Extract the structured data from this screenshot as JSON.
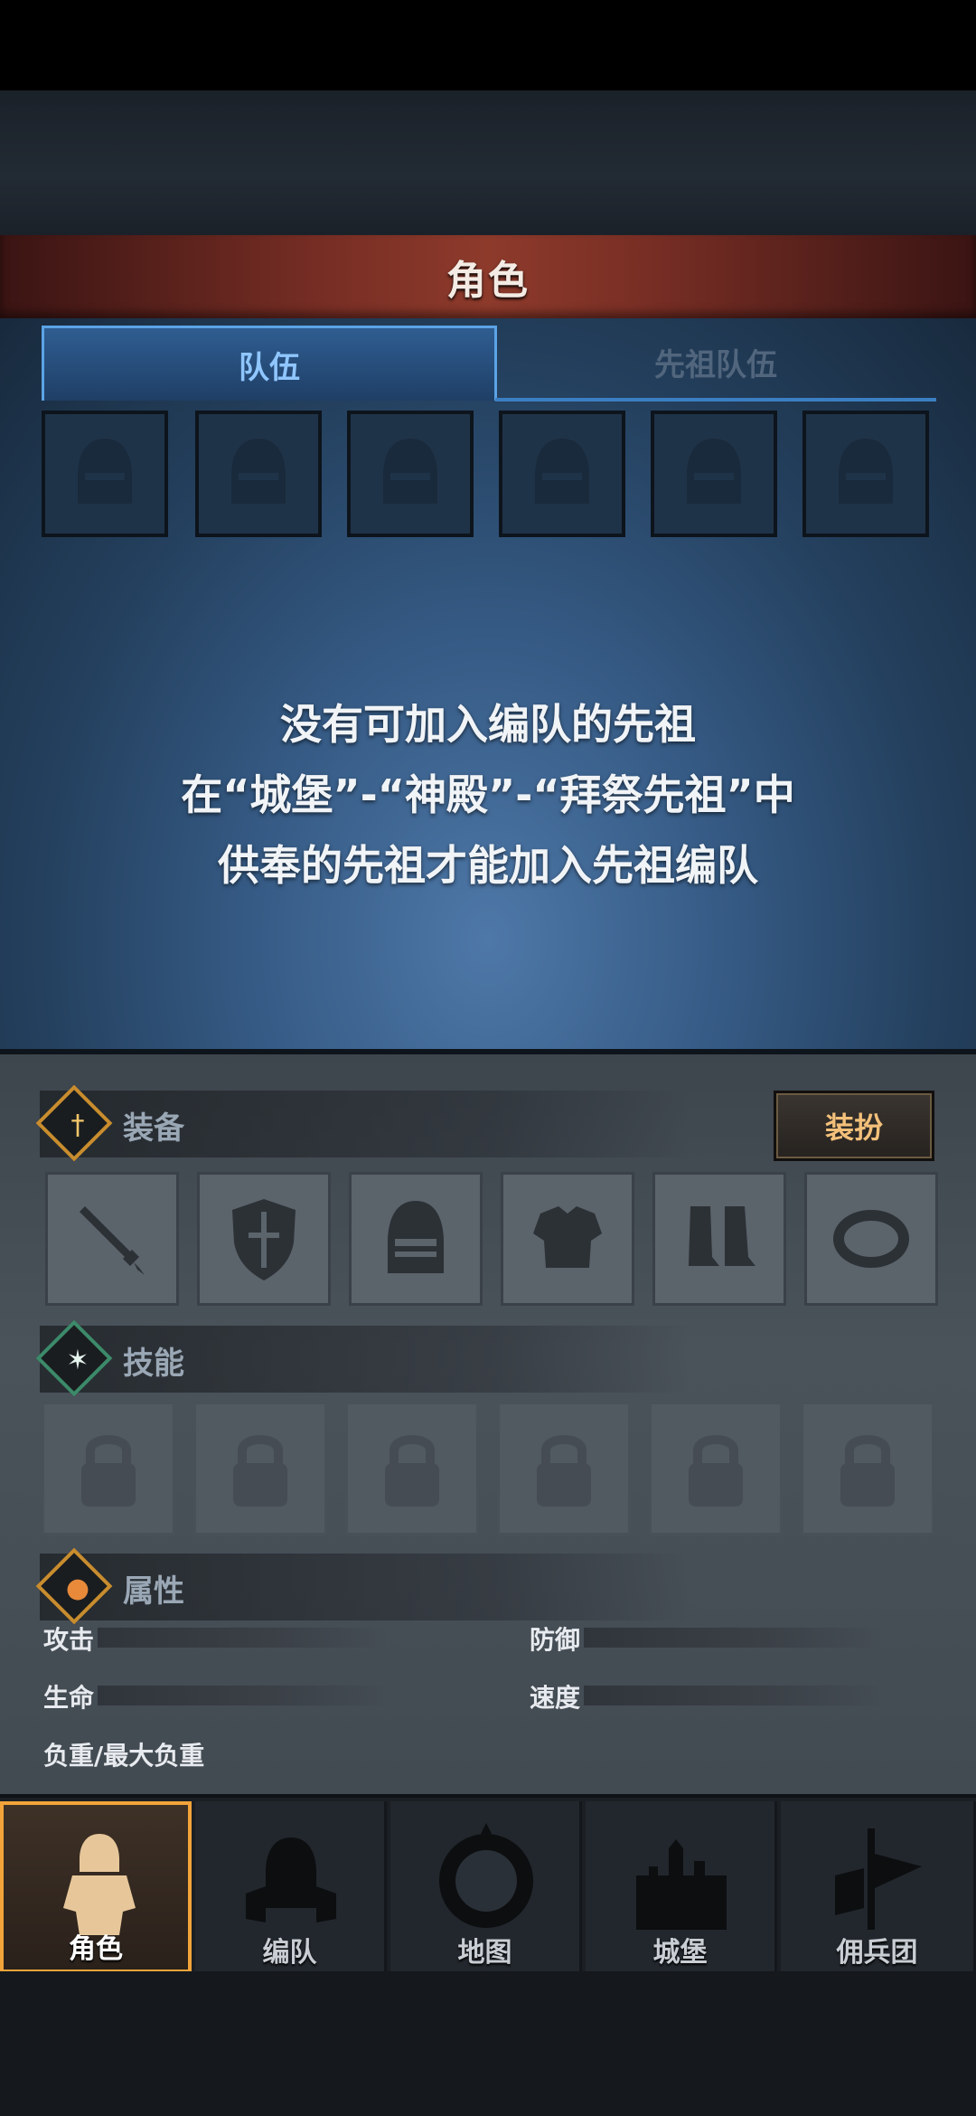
{
  "header": {
    "title": "角色"
  },
  "tabs": [
    {
      "label": "队伍",
      "active": true
    },
    {
      "label": "先祖队伍",
      "active": false
    }
  ],
  "message": {
    "line1": "没有可加入编队的先祖",
    "line2": "在“城堡”-“神殿”-“拜祭先祖”中",
    "line3": "供奉的先祖才能加入先祖编队"
  },
  "equipment": {
    "title": "装备",
    "dress_button": "装扮",
    "slots": [
      "sword-icon",
      "shield-icon",
      "helmet-icon",
      "armor-icon",
      "boots-icon",
      "ring-icon"
    ]
  },
  "skills": {
    "title": "技能",
    "slots_locked": 6
  },
  "attributes": {
    "title": "属性",
    "attack": "攻击",
    "defense": "防御",
    "life": "生命",
    "speed": "速度",
    "weight": "负重/最大负重"
  },
  "nav": [
    {
      "label": "角色",
      "icon": "knight-icon",
      "active": true
    },
    {
      "label": "编队",
      "icon": "squad-icon",
      "active": false
    },
    {
      "label": "地图",
      "icon": "compass-map-icon",
      "active": false
    },
    {
      "label": "城堡",
      "icon": "castle-icon",
      "active": false
    },
    {
      "label": "佣兵团",
      "icon": "mercenary-banner-icon",
      "active": false
    }
  ],
  "colors": {
    "accent": "#f2a43a",
    "tab_active": "#8fc6ff",
    "title_bar": "#8d3a2b"
  }
}
